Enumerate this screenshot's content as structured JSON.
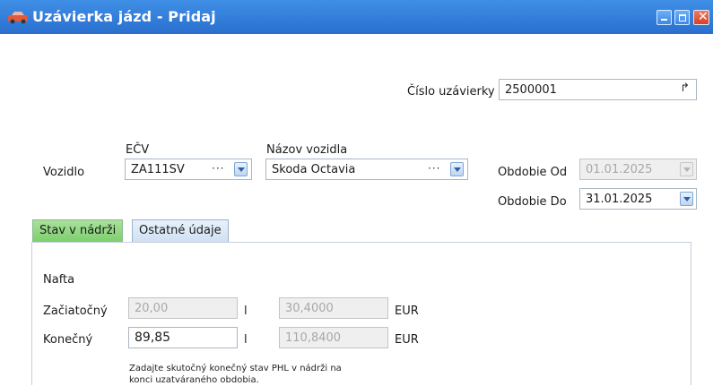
{
  "window": {
    "title": "Uzávierka jázd - Pridaj"
  },
  "header": {
    "closure_number_label": "Číslo uzávierky",
    "closure_number_value": "2500001"
  },
  "vehicle": {
    "label": "Vozidlo",
    "ecv_label": "EČV",
    "ecv_value": "ZA111SV",
    "name_label": "Názov vozidla",
    "name_value": "Škoda Octavia",
    "dots": "···"
  },
  "period": {
    "from_label": "Obdobie Od",
    "from_value": "01.01.2025",
    "to_label": "Obdobie Do",
    "to_value": "31.01.2025"
  },
  "tabs": [
    {
      "label": "Stav v nádrži",
      "active": true
    },
    {
      "label": "Ostatné údaje",
      "active": false
    }
  ],
  "fuel": {
    "type": "Nafta",
    "start_label": "Začiatočný",
    "start_volume": "20,00",
    "start_unit": "l",
    "start_amount": "30,4000",
    "start_currency": "EUR",
    "end_label": "Konečný",
    "end_volume": "89,85",
    "end_unit": "l",
    "end_amount": "110,8400",
    "end_currency": "EUR",
    "note_line1": "Zadajte skutočný konečný stav PHL v nádrži na",
    "note_line2": "konci uzatváraného obdobia."
  },
  "icons": {
    "app": "car-icon",
    "minimize": "minimize-icon",
    "maximize": "maximize-icon",
    "close": "close-icon",
    "cursor": "cursor-icon"
  },
  "colors": {
    "titlebar": "#2a6fcf",
    "active_tab": "#7ccd6d",
    "close_button": "#d34327"
  }
}
